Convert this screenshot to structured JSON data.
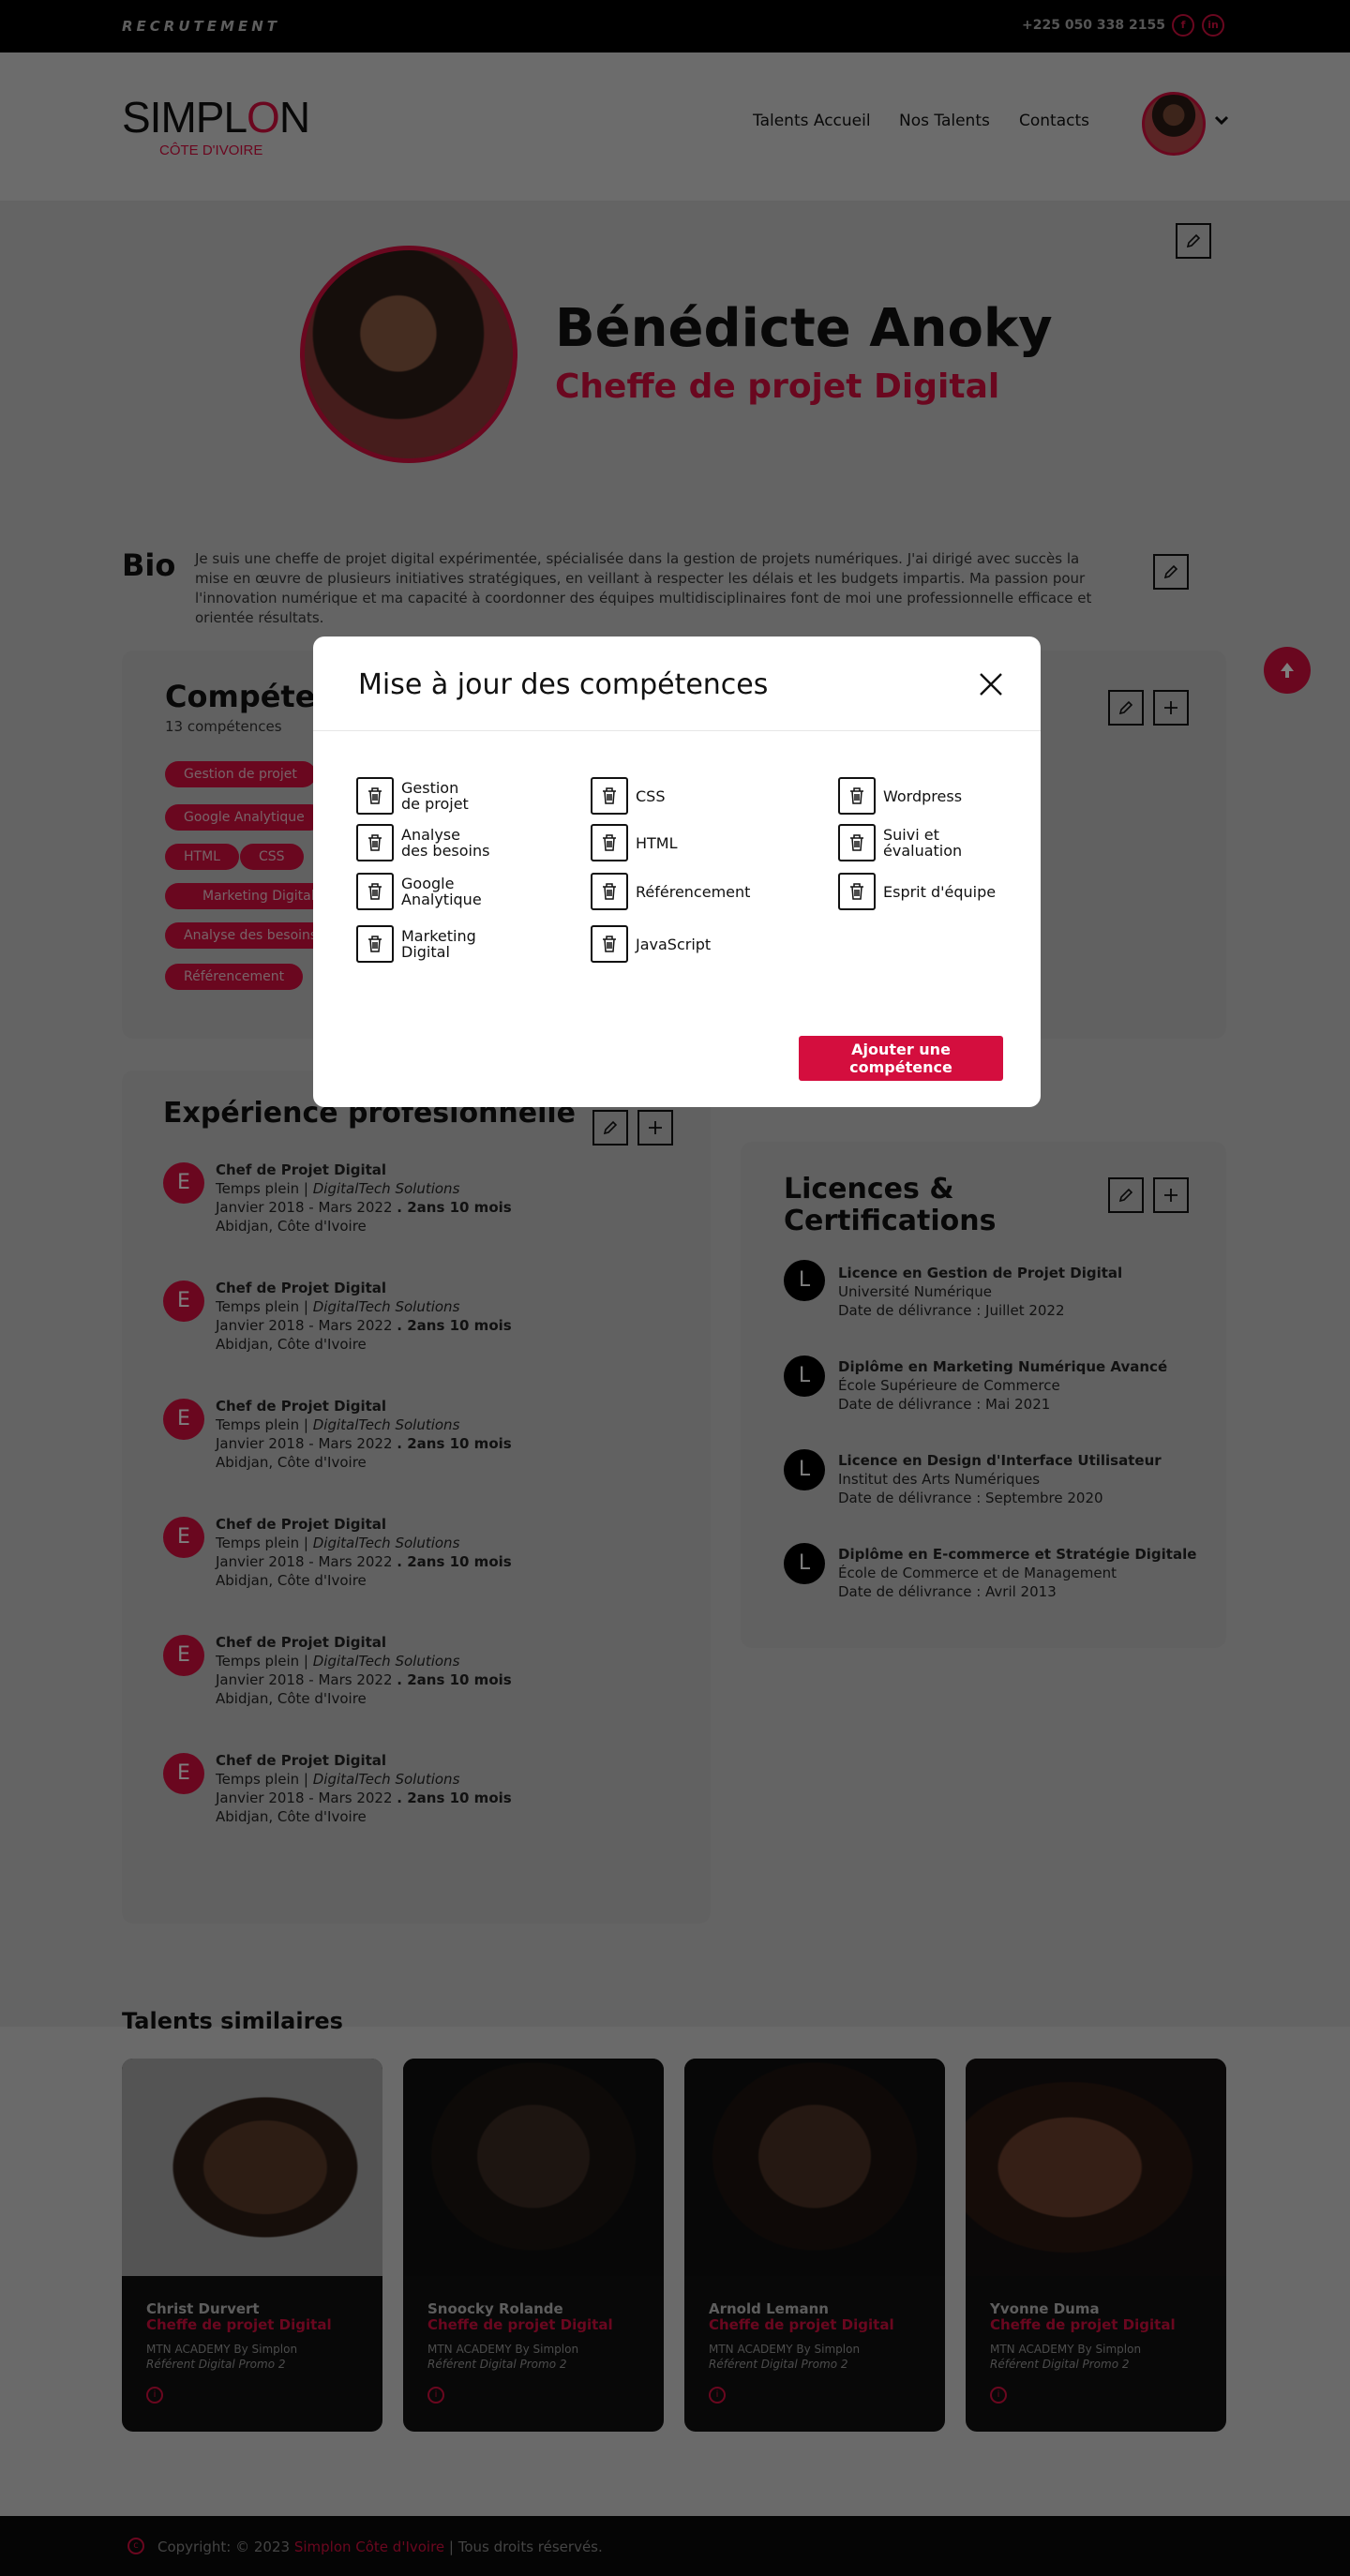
{
  "topbar": {
    "brand": "RECRUTEMENT",
    "phone": "+225 050 338 2155",
    "social": [
      "f",
      "in"
    ]
  },
  "header": {
    "logo_main": "SIMPL",
    "logo_o": "O",
    "logo_end": "N",
    "logo_sub": "CÔTE D'IVOIRE",
    "nav": [
      "Talents Accueil",
      "Nos Talents",
      "Contacts"
    ]
  },
  "profile": {
    "name": "Bénédicte Anoky",
    "title": "Cheffe de projet Digital"
  },
  "bio": {
    "label": "Bio",
    "text": "Je suis une cheffe de projet digital expérimentée, spécialisée dans la gestion de projets numériques. J'ai dirigé avec succès la mise en œuvre de plusieurs initiatives stratégiques, en veillant à respecter les délais et les budgets impartis. Ma passion pour l'innovation numérique et ma capacité à coordonner des équipes multidisciplinaires font de moi une professionnelle efficace et orientée résultats."
  },
  "competences": {
    "title": "Compétences",
    "count": "13 compétences",
    "tags": [
      "Gestion de projet",
      "Google Analytique",
      "HTML",
      "CSS",
      "Marketing Digital",
      "Analyse des besoins",
      "Référencement"
    ]
  },
  "experience": {
    "title": "Expérience profesionnelle",
    "items": [
      {
        "letter": "E",
        "title": "Chef de Projet Digital",
        "type": "Temps plein | ",
        "company": "DigitalTech Solutions",
        "dates": "Janvier 2018 - Mars 2022 ",
        "duration": ". 2ans 10 mois",
        "location": "Abidjan, Côte d'Ivoire"
      },
      {
        "letter": "E",
        "title": "Chef de Projet Digital",
        "type": "Temps plein | ",
        "company": "DigitalTech Solutions",
        "dates": "Janvier 2018 - Mars 2022 ",
        "duration": ". 2ans 10 mois",
        "location": "Abidjan, Côte d'Ivoire"
      },
      {
        "letter": "E",
        "title": "Chef de Projet Digital",
        "type": "Temps plein | ",
        "company": "DigitalTech Solutions",
        "dates": "Janvier 2018 - Mars 2022 ",
        "duration": ". 2ans 10 mois",
        "location": "Abidjan, Côte d'Ivoire"
      },
      {
        "letter": "E",
        "title": "Chef de Projet Digital",
        "type": "Temps plein | ",
        "company": "DigitalTech Solutions",
        "dates": "Janvier 2018 - Mars 2022 ",
        "duration": ". 2ans 10 mois",
        "location": "Abidjan, Côte d'Ivoire"
      },
      {
        "letter": "E",
        "title": "Chef de Projet Digital",
        "type": "Temps plein | ",
        "company": "DigitalTech Solutions",
        "dates": "Janvier 2018 - Mars 2022 ",
        "duration": ". 2ans 10 mois",
        "location": "Abidjan, Côte d'Ivoire"
      },
      {
        "letter": "E",
        "title": "Chef de Projet Digital",
        "type": "Temps plein | ",
        "company": "DigitalTech Solutions",
        "dates": "Janvier 2018 - Mars 2022 ",
        "duration": ". 2ans 10 mois",
        "location": "Abidjan, Côte d'Ivoire"
      }
    ]
  },
  "licences": {
    "title_line1": "Licences &",
    "title_line2": "Certifications",
    "items": [
      {
        "letter": "L",
        "title": "Licence en Gestion de Projet Digital",
        "school": "Université Numérique",
        "date": "Date de délivrance : Juillet 2022"
      },
      {
        "letter": "L",
        "title": "Diplôme en Marketing Numérique Avancé",
        "school": "École Supérieure de Commerce",
        "date": "Date de délivrance : Mai 2021"
      },
      {
        "letter": "L",
        "title": "Licence en Design d'Interface Utilisateur",
        "school": "Institut des Arts Numériques",
        "date": "Date de délivrance : Septembre 2020"
      },
      {
        "letter": "L",
        "title": "Diplôme en E-commerce et Stratégie Digitale",
        "school": "École de Commerce et de Management",
        "date": "Date de délivrance : Avril 2013"
      }
    ]
  },
  "similar": {
    "title": "Talents similaires",
    "cards": [
      {
        "name": "Christ Durvert",
        "role": "Cheffe de projet Digital",
        "academy": "MTN ACADEMY By Simplon",
        "promo": "Référent Digital Promo 2"
      },
      {
        "name": "Snoocky Rolande",
        "role": "Cheffe de projet Digital",
        "academy": "MTN ACADEMY By Simplon",
        "promo": "Référent Digital Promo 2"
      },
      {
        "name": "Arnold Lemann",
        "role": "Cheffe de projet Digital",
        "academy": "MTN ACADEMY By Simplon",
        "promo": "Référent Digital Promo 2"
      },
      {
        "name": "Yvonne Duma",
        "role": "Cheffe de projet Digital",
        "academy": "MTN ACADEMY By Simplon",
        "promo": "Référent Digital Promo 2"
      }
    ]
  },
  "footer": {
    "prefix": "Copyright: © 2023 ",
    "brand": "Simplon Côte d'Ivoire",
    "suffix": " | Tous droits réservés."
  },
  "modal": {
    "title": "Mise à jour des compétences",
    "skills": [
      {
        "line1": "Gestion",
        "line2": "de projet"
      },
      {
        "line1": "CSS",
        "line2": ""
      },
      {
        "line1": "Wordpress",
        "line2": ""
      },
      {
        "line1": "Analyse",
        "line2": "des besoins"
      },
      {
        "line1": "HTML",
        "line2": ""
      },
      {
        "line1": "Suivi et",
        "line2": "évaluation"
      },
      {
        "line1": "Google",
        "line2": "Analytique"
      },
      {
        "line1": "Référencement",
        "line2": ""
      },
      {
        "line1": "Esprit d'équipe",
        "line2": ""
      },
      {
        "line1": "Marketing",
        "line2": "Digital"
      },
      {
        "line1": "JavaScript",
        "line2": ""
      }
    ],
    "add_button": "Ajouter une compétence"
  },
  "colors": {
    "accent": "#d40e3e",
    "overlay": "rgba(0,0,0,0.5)"
  },
  "icons": [
    "pencil-icon",
    "plus-icon",
    "trash-icon",
    "close-icon",
    "arrow-up-icon",
    "chevron-down-icon",
    "info-icon"
  ]
}
